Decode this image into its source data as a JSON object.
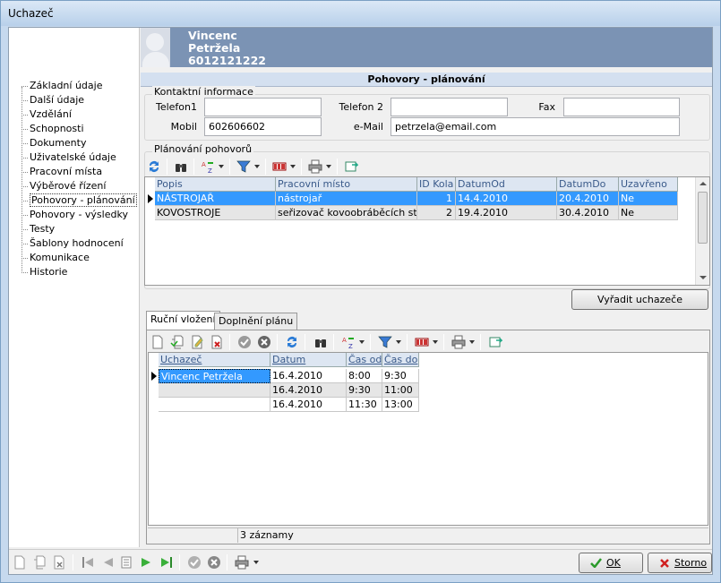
{
  "window": {
    "title": "Uchazeč"
  },
  "nav": {
    "items": [
      {
        "label": "Základní údaje"
      },
      {
        "label": "Další údaje"
      },
      {
        "label": "Vzdělání"
      },
      {
        "label": "Schopnosti"
      },
      {
        "label": "Dokumenty"
      },
      {
        "label": "Uživatelské údaje"
      },
      {
        "label": "Pracovní místa"
      },
      {
        "label": "Výběrové řízení"
      },
      {
        "label": "Pohovory - plánování"
      },
      {
        "label": "Pohovory - výsledky"
      },
      {
        "label": "Testy"
      },
      {
        "label": "Šablony hodnocení"
      },
      {
        "label": "Komunikace"
      },
      {
        "label": "Historie"
      }
    ],
    "selected": "Pohovory - plánování"
  },
  "header": {
    "first_name": "Vincenc",
    "last_name": "Petržela",
    "id_number": "6012121222"
  },
  "section": {
    "title": "Pohovory - plánování"
  },
  "contact": {
    "group_title": "Kontaktní informace",
    "telefon1_label": "Telefon1",
    "telefon1_value": "",
    "telefon2_label": "Telefon 2",
    "telefon2_value": "",
    "fax_label": "Fax",
    "fax_value": "",
    "mobil_label": "Mobil",
    "mobil_value": "602606602",
    "email_label": "e-Mail",
    "email_value": "petrzela@email.com"
  },
  "planning": {
    "group_title": "Plánování pohovorů",
    "columns": [
      "Popis",
      "Pracovní místo",
      "ID Kola",
      "DatumOd",
      "DatumDo",
      "Uzavřeno"
    ],
    "rows": [
      [
        "NÁSTROJAŘ",
        "nástrojař",
        "1",
        "14.4.2010",
        "20.4.2010",
        "Ne"
      ],
      [
        "KOVOSTROJE",
        "seřizovač kovoobráběcích strojů",
        "2",
        "19.4.2010",
        "30.4.2010",
        "Ne"
      ]
    ]
  },
  "exclude_button": "Vyřadit uchazeče",
  "tabs": [
    {
      "label": "Ruční vložení"
    },
    {
      "label": "Doplnění plánu"
    }
  ],
  "manual": {
    "columns": [
      "Uchazeč",
      "Datum",
      "Čas od",
      "Čas do"
    ],
    "rows": [
      [
        "Vincenc Petržela",
        "16.4.2010",
        "8:00",
        "9:30"
      ],
      [
        "",
        "16.4.2010",
        "9:30",
        "11:00"
      ],
      [
        "",
        "16.4.2010",
        "11:30",
        "13:00"
      ]
    ],
    "status": "3 záznamy"
  },
  "footer": {
    "ok_label": "OK",
    "cancel_label": "Storno"
  },
  "colors": {
    "selection": "#3399ff",
    "header_band": "#7b93b4",
    "grid_header_text": "#3a5a8a"
  }
}
